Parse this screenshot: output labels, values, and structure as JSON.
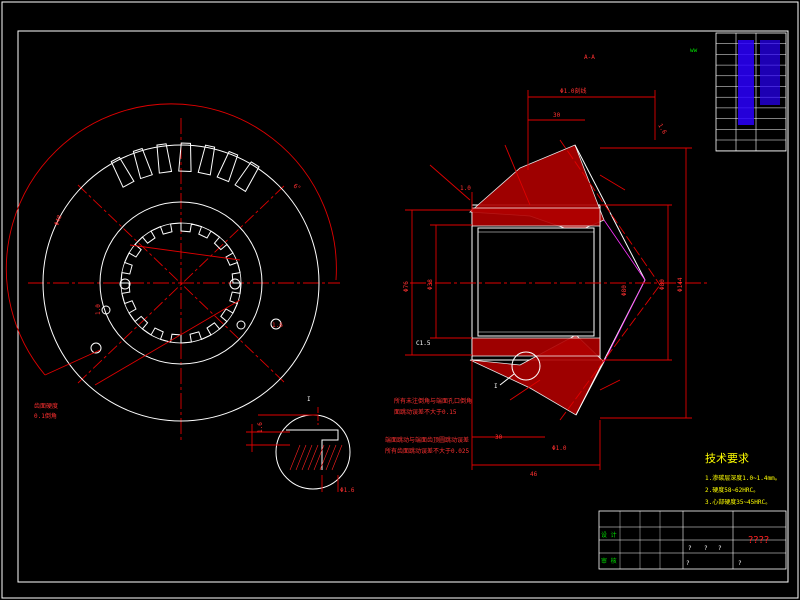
{
  "section_label": "A-A",
  "section_b_label": "I",
  "detail_marker": "I",
  "dims": {
    "d_top": "Φ1.0刻线",
    "d_a": "30",
    "d_b": "1.6",
    "d_c": "1.0",
    "d_left1": "Φ76",
    "d_left2": "Φ38",
    "d_bore": "Φ80",
    "d_right1": "Φ80",
    "d_right2": "Φ144",
    "d_c1": "C1.5",
    "d_bot1": "30",
    "d_bot2": "46",
    "d_bot3": "Φ1.0",
    "d_key1": "1.6",
    "d_key2": "Φ1.6",
    "d_circ1": "6°",
    "d_circ2": "Φ48",
    "d_note_a": "齿面硬度",
    "d_note_b": "0.1倒角"
  },
  "center_notes": [
    "所有未注倒角与端面孔口倒角",
    "面跳动误差不大于0.15",
    "端面跳动与端面齿顶圆跳动误差",
    "所有齿面跳动误差不大于0.025"
  ],
  "tech": {
    "title": "技术要求",
    "items": [
      "1.渗碳层深度1.0~1.4mm。",
      "2.硬度58~62HRC。",
      "3.心部硬度35~45HRC。"
    ]
  },
  "title_block": {
    "name": "????",
    "row_labels": [
      "设 计",
      "审 核"
    ],
    "cells": [
      "?",
      "?",
      "?",
      "?",
      "?"
    ]
  },
  "colors": {
    "background": "#000000",
    "outline": "#ffffff",
    "dimension": "#ff2020",
    "hatch": "#ff2020",
    "table_accent": "#0000ff",
    "note_yellow": "#ffff00"
  }
}
